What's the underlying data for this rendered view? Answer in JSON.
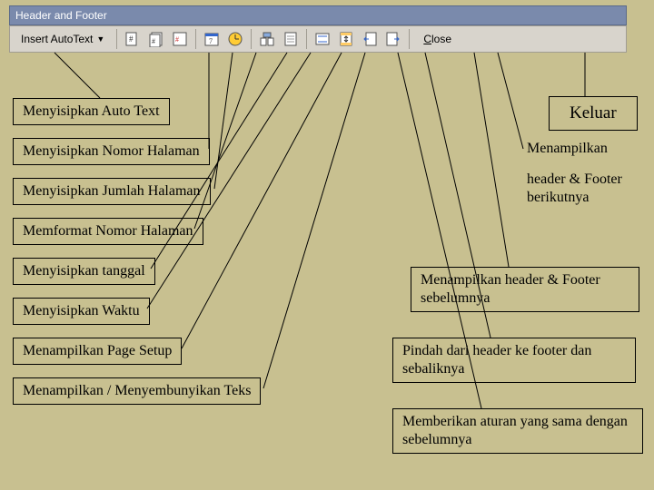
{
  "titlebar": "Header and Footer",
  "toolbar": {
    "autotext_label": "Insert AutoText",
    "close_label": "Close"
  },
  "icons": [
    "page-number-icon",
    "num-pages-icon",
    "format-page-number-icon",
    "date-icon",
    "time-icon",
    "page-setup-icon",
    "show-hide-text-icon",
    "same-as-previous-icon",
    "switch-header-footer-icon",
    "show-previous-icon",
    "show-next-icon"
  ],
  "labels": {
    "l_autotext": "Menyisipkan Auto Text",
    "l_pagenum": "Menyisipkan Nomor Halaman",
    "l_numpages": "Menyisipkan Jumlah Halaman",
    "l_format": "Memformat Nomor Halaman",
    "l_date": "Menyisipkan tanggal",
    "l_time": "Menyisipkan Waktu",
    "l_pagesetup": "Menampilkan Page Setup",
    "l_showhide": "Menampilkan / Menyembunyikan Teks",
    "l_close": "Keluar",
    "l_next_a": "Menampilkan",
    "l_next_b": "header & Footer berikutnya",
    "l_prev": "Menampilkan header & Footer sebelumnya",
    "l_switch": "Pindah dari header ke footer dan sebaliknya",
    "l_same": "Memberikan aturan yang sama dengan sebelumnya"
  }
}
